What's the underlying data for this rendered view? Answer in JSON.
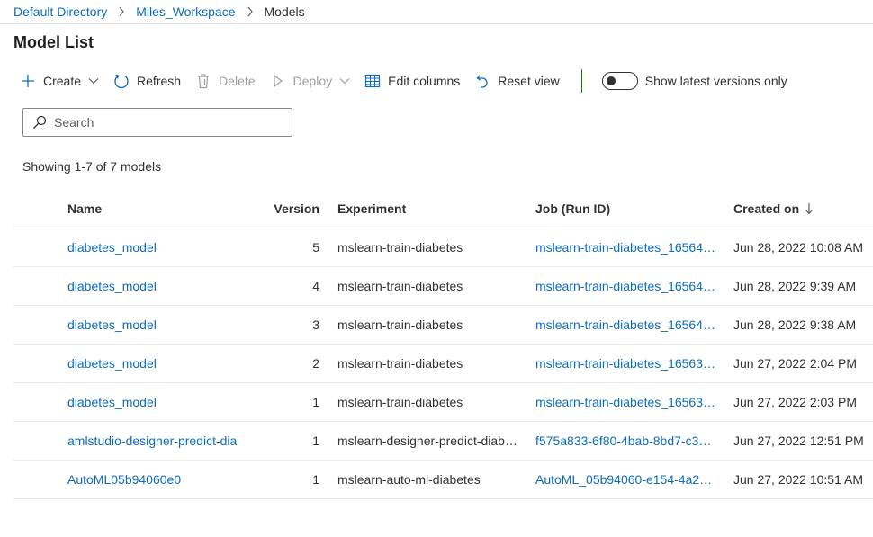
{
  "breadcrumb": {
    "items": [
      "Default Directory",
      "Miles_Workspace"
    ],
    "current": "Models"
  },
  "page_title": "Model List",
  "toolbar": {
    "create": "Create",
    "refresh": "Refresh",
    "delete": "Delete",
    "deploy": "Deploy",
    "edit_columns": "Edit columns",
    "reset_view": "Reset view",
    "toggle_label": "Show latest versions only",
    "toggle_on": false
  },
  "search": {
    "placeholder": "Search",
    "value": ""
  },
  "showing": "Showing 1-7 of 7 models",
  "table": {
    "columns": {
      "name": "Name",
      "version": "Version",
      "experiment": "Experiment",
      "job": "Job (Run ID)",
      "created": "Created on"
    },
    "sort": {
      "column": "created",
      "direction": "descending"
    },
    "rows": [
      {
        "name": "diabetes_model",
        "version": "5",
        "experiment": "mslearn-train-diabetes",
        "job": "mslearn-train-diabetes_165643...",
        "created": "Jun 28, 2022 10:08 AM"
      },
      {
        "name": "diabetes_model",
        "version": "4",
        "experiment": "mslearn-train-diabetes",
        "job": "mslearn-train-diabetes_165643...",
        "created": "Jun 28, 2022 9:39 AM"
      },
      {
        "name": "diabetes_model",
        "version": "3",
        "experiment": "mslearn-train-diabetes",
        "job": "mslearn-train-diabetes_165643...",
        "created": "Jun 28, 2022 9:38 AM"
      },
      {
        "name": "diabetes_model",
        "version": "2",
        "experiment": "mslearn-train-diabetes",
        "job": "mslearn-train-diabetes_165636...",
        "created": "Jun 27, 2022 2:04 PM"
      },
      {
        "name": "diabetes_model",
        "version": "1",
        "experiment": "mslearn-train-diabetes",
        "job": "mslearn-train-diabetes_165636...",
        "created": "Jun 27, 2022 2:03 PM"
      },
      {
        "name": "amlstudio-designer-predict-dia",
        "version": "1",
        "experiment": "mslearn-designer-predict-diabe...",
        "job": "f575a833-6f80-4bab-8bd7-c3d...",
        "created": "Jun 27, 2022 12:51 PM"
      },
      {
        "name": "AutoML05b94060e0",
        "version": "1",
        "experiment": "mslearn-auto-ml-diabetes",
        "job": "AutoML_05b94060-e154-4a2a-...",
        "created": "Jun 27, 2022 10:51 AM"
      }
    ]
  },
  "colors": {
    "link": "#0f6cbd",
    "separator": "#107c10",
    "disabled": "#a19f9d",
    "text": "#323130"
  },
  "icons": {
    "create": "plus-icon",
    "refresh": "refresh-icon",
    "delete": "trash-icon",
    "deploy": "play-icon",
    "edit_columns": "table-columns-icon",
    "reset_view": "undo-icon",
    "search": "search-icon",
    "sort": "arrow-down-icon",
    "breadcrumb_sep": "chevron-right-icon"
  }
}
